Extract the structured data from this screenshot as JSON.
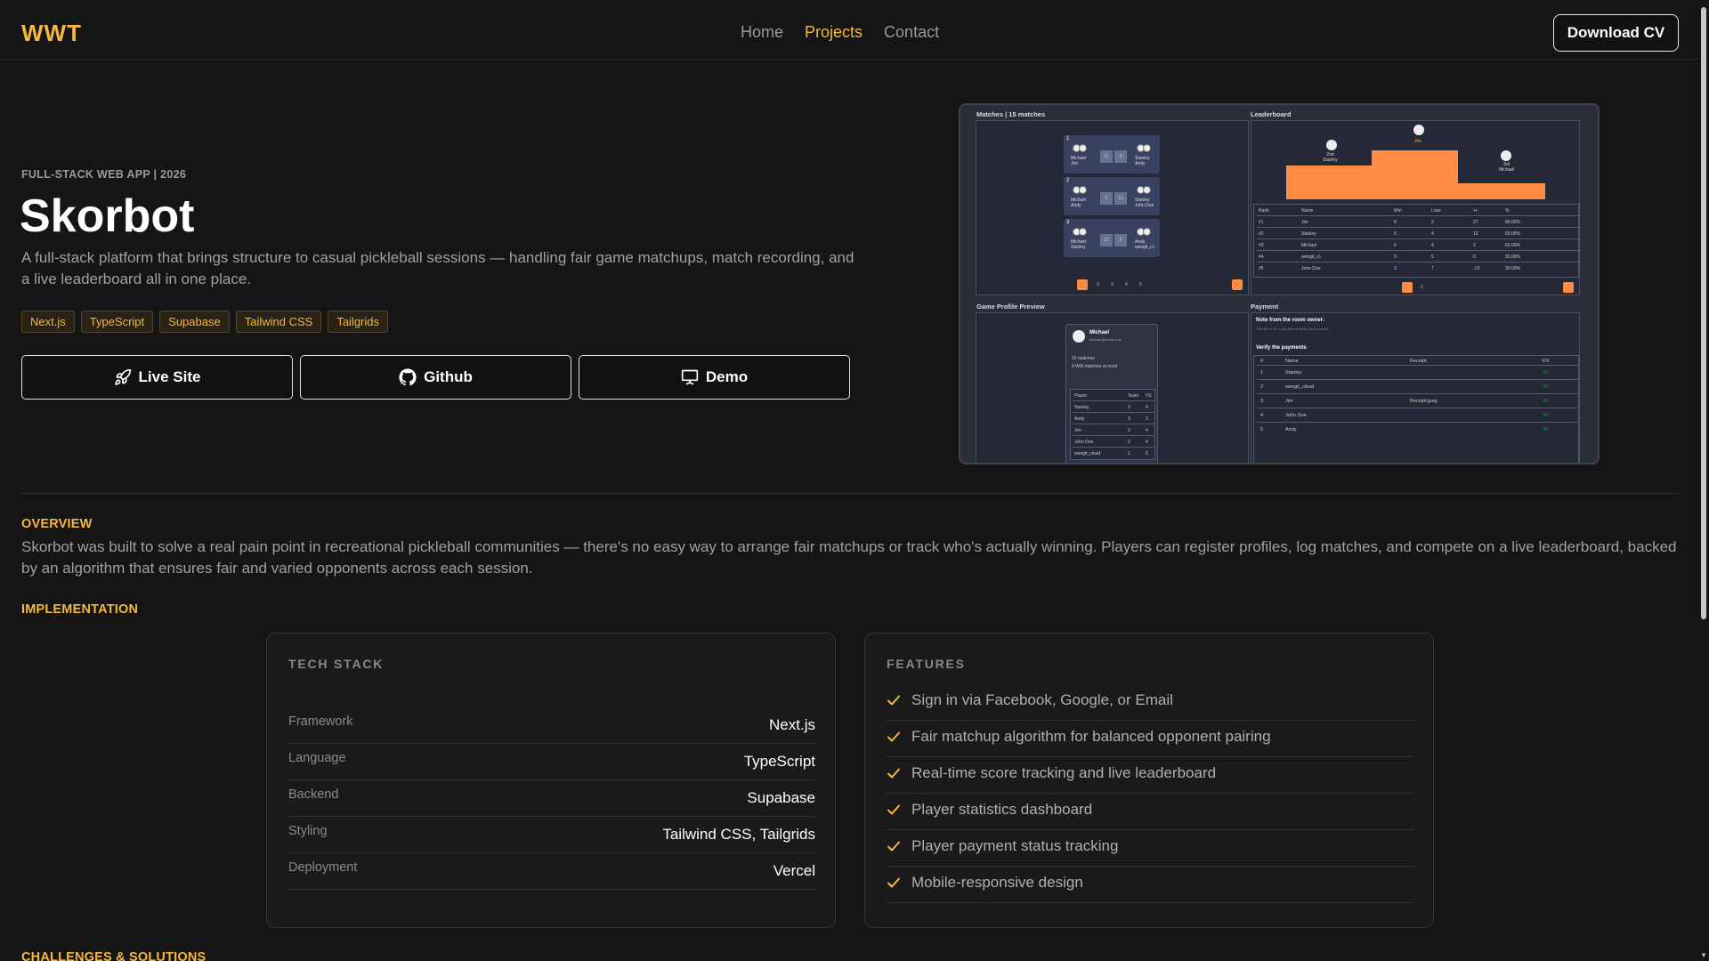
{
  "header": {
    "logo": "WWT",
    "nav": [
      "Home",
      "Projects",
      "Contact"
    ],
    "active_nav": "Projects",
    "cv_button": "Download CV"
  },
  "hero": {
    "eyebrow": "FULL-STACK WEB APP | 2026",
    "title": "Skorbot",
    "description": "A full-stack platform that brings structure to casual pickleball sessions — handling fair game matchups, match recording, and a live leaderboard all in one place.",
    "tags": [
      "Next.js",
      "TypeScript",
      "Supabase",
      "Tailwind CSS",
      "Tailgrids"
    ],
    "actions": {
      "live": "Live Site",
      "github": "Github",
      "demo": "Demo"
    }
  },
  "preview": {
    "matches_title": "Matches | 15 matches",
    "leaderboard_title": "Leaderboard",
    "profile_title": "Game Profile Preview",
    "payment_title": "Payment",
    "matches": [
      {
        "n": "1",
        "left": "Michael\nJim",
        "right": "Stanley\nAndy",
        "s1": "11",
        "s2": "4"
      },
      {
        "n": "2",
        "left": "Michael\nAndy",
        "right": "Stanley\nJohn Doe",
        "s1": "6",
        "s2": "11"
      },
      {
        "n": "3",
        "left": "Michael\nStanley",
        "right": "Andy\nwengti_cl..",
        "s1": "11",
        "s2": "9"
      }
    ],
    "podium": {
      "first": "Jim",
      "second": "2nd\nStanley",
      "third": "3rd\nMichael"
    },
    "leaderboard_headers": [
      "Rank",
      "Name",
      "Win",
      "Lose",
      "+/-",
      "%"
    ],
    "leaderboard_rows": [
      [
        "#1",
        "Jim",
        "8",
        "2",
        "27",
        "80.00%"
      ],
      [
        "#2",
        "Stanley",
        "6",
        "4",
        "12",
        "60.00%"
      ],
      [
        "#3",
        "Michael",
        "6",
        "4",
        "3",
        "60.00%"
      ],
      [
        "#4",
        "wengti_cl..",
        "5",
        "5",
        "0",
        "50.00%"
      ],
      [
        "#5",
        "John Doe",
        "3",
        "7",
        "-13",
        "30.00%"
      ]
    ],
    "profile": {
      "name": "Michael",
      "email": "michael@email.com",
      "matches": "10 matches",
      "streak": "4 W/8 matches at most",
      "table_headers": [
        "Player",
        "Team",
        "VS"
      ],
      "table_rows": [
        [
          "Stanley",
          "2",
          "4"
        ],
        [
          "Andy",
          "3",
          "3"
        ],
        [
          "Jim",
          "2",
          "4"
        ],
        [
          "John Doe",
          "2",
          "4"
        ],
        [
          "wengti_cloud",
          "1",
          "5"
        ]
      ]
    },
    "payment": {
      "note_title": "Note from the room owner:",
      "note_text": "The fee of 15 is per person (RM 5 per person)",
      "verify_title": "Verify the payments",
      "headers": [
        "#",
        "Name",
        "Receipt",
        "V/X"
      ],
      "rows": [
        [
          "1",
          "Stanley",
          ""
        ],
        [
          "2",
          "wengti_cloud",
          ""
        ],
        [
          "3",
          "Jim",
          "Receipt.jpeg"
        ],
        [
          "4",
          "John Doe",
          ""
        ],
        [
          "5",
          "Andy",
          ""
        ]
      ]
    }
  },
  "overview": {
    "label": "OVERVIEW",
    "text": "Skorbot was built to solve a real pain point in recreational pickleball communities — there's no easy way to arrange fair matchups or track who's actually winning. Players can register profiles, log matches, and compete on a live leaderboard, backed by an algorithm that ensures fair and varied opponents across each session."
  },
  "implementation": {
    "label": "IMPLEMENTATION",
    "tech_title": "TECH STACK",
    "tech": [
      {
        "k": "Framework",
        "v": "Next.js"
      },
      {
        "k": "Language",
        "v": "TypeScript"
      },
      {
        "k": "Backend",
        "v": "Supabase"
      },
      {
        "k": "Styling",
        "v": "Tailwind CSS, Tailgrids"
      },
      {
        "k": "Deployment",
        "v": "Vercel"
      }
    ],
    "features_title": "FEATURES",
    "features": [
      "Sign in via Facebook, Google, or Email",
      "Fair matchup algorithm for balanced opponent pairing",
      "Real-time score tracking and live leaderboard",
      "Player statistics dashboard",
      "Player payment status tracking",
      "Mobile-responsive design"
    ]
  },
  "challenges": {
    "label": "CHALLENGES & SOLUTIONS"
  },
  "colors": {
    "accent": "#f5b83d",
    "background": "#151515",
    "preview_accent": "#ff8c42"
  }
}
